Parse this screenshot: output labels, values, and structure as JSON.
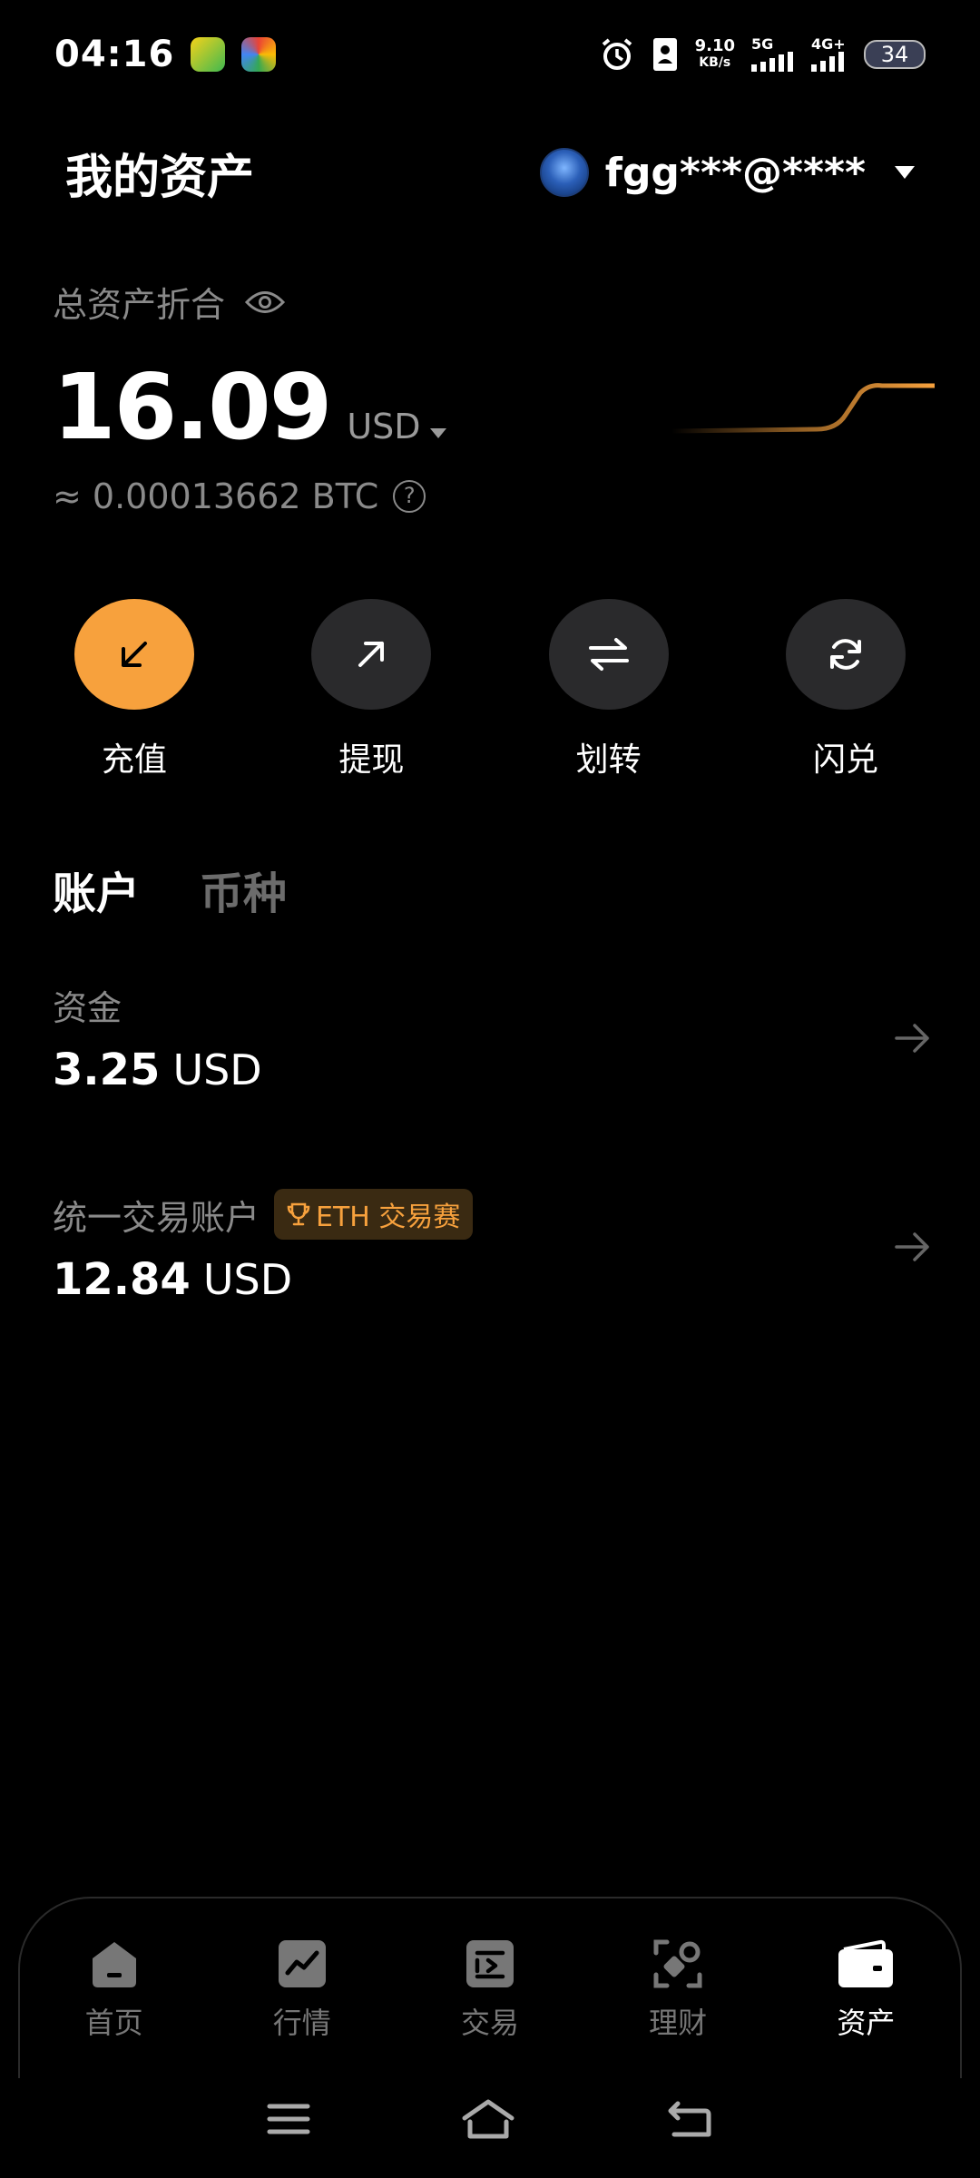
{
  "status_bar": {
    "time": "04:16",
    "net_speed_value": "9.10",
    "net_speed_unit": "KB/s",
    "signal_1": "5G",
    "signal_2": "4G+",
    "battery": "34",
    "icons": [
      "app-icon-qq-music",
      "app-icon-colorful",
      "alarm-icon",
      "contact-card-icon",
      "signal-icon",
      "signal-icon",
      "battery-icon"
    ]
  },
  "header": {
    "title": "我的资产",
    "account": "fgg***@****"
  },
  "summary": {
    "label": "总资产折合",
    "amount": "16.09",
    "unit": "USD",
    "btc_equiv": "≈ 0.00013662 BTC",
    "help": "?",
    "accent": "#f7a13d"
  },
  "actions": [
    {
      "label": "充值",
      "icon": "deposit-arrow-icon"
    },
    {
      "label": "提现",
      "icon": "withdraw-arrow-icon"
    },
    {
      "label": "划转",
      "icon": "transfer-icon"
    },
    {
      "label": "闪兑",
      "icon": "swap-refresh-icon"
    }
  ],
  "tabs": [
    {
      "label": "账户",
      "active": true
    },
    {
      "label": "币种",
      "active": false
    }
  ],
  "accounts": [
    {
      "name": "资金",
      "amount": "3.25",
      "unit": "USD"
    },
    {
      "name": "统一交易账户",
      "badge": "ETH 交易赛",
      "amount": "12.84",
      "unit": "USD"
    }
  ],
  "bottom_nav": [
    {
      "label": "首页",
      "icon": "home-icon",
      "active": false
    },
    {
      "label": "行情",
      "icon": "market-chart-icon",
      "active": false
    },
    {
      "label": "交易",
      "icon": "trade-icon",
      "active": false
    },
    {
      "label": "理财",
      "icon": "earn-icon",
      "active": false
    },
    {
      "label": "资产",
      "icon": "wallet-icon",
      "active": true
    }
  ]
}
